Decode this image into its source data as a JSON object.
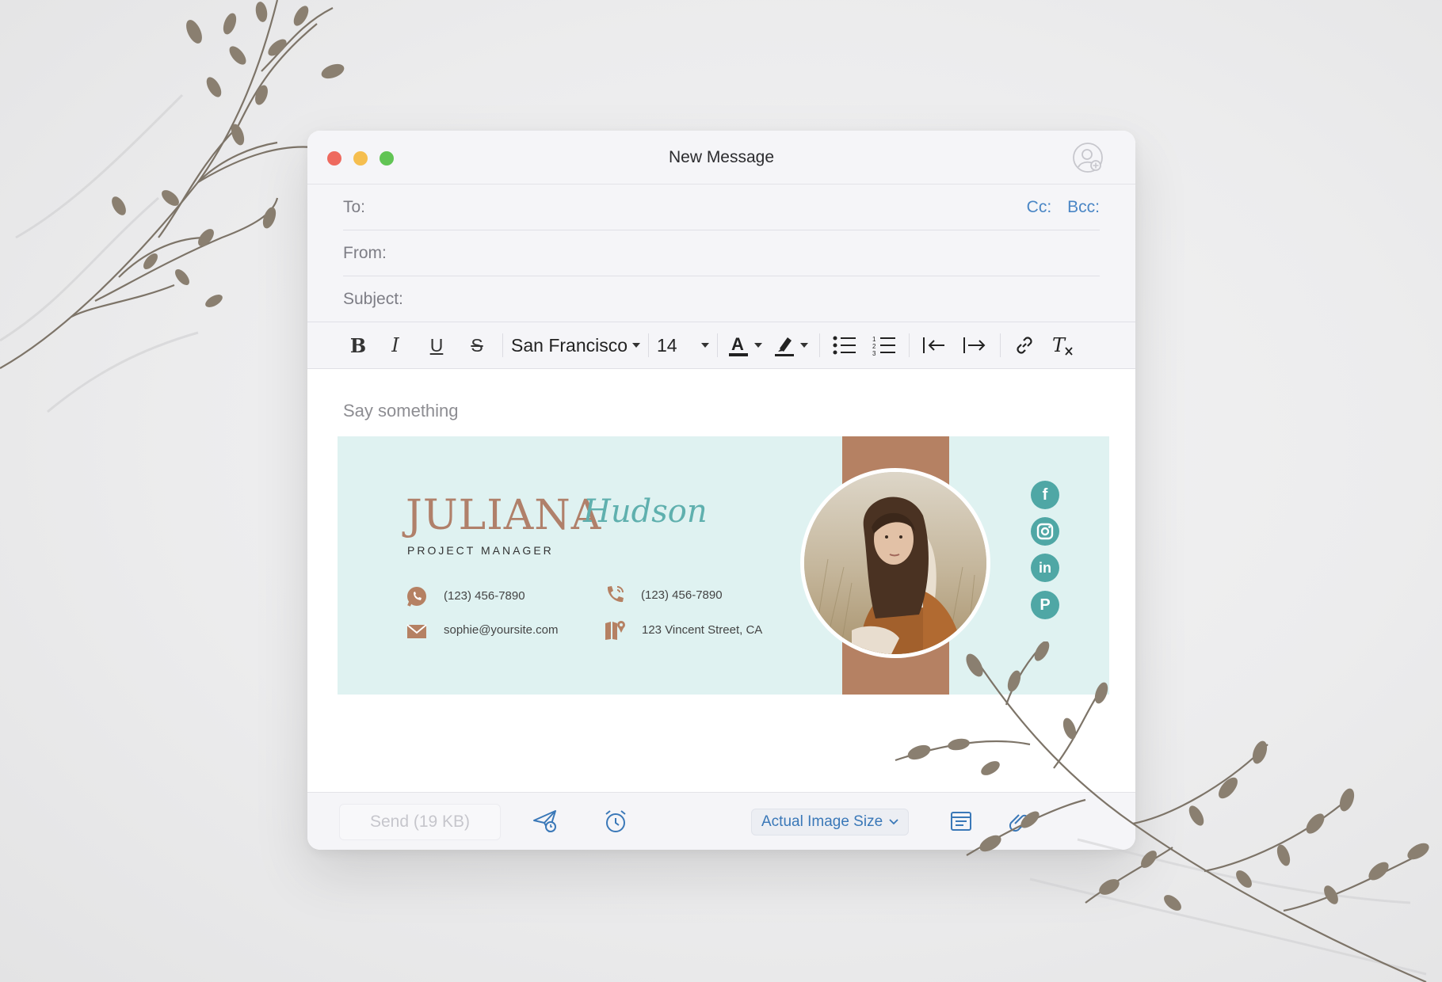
{
  "window": {
    "title": "New Message"
  },
  "headers": {
    "to_label": "To:",
    "from_label": "From:",
    "subject_label": "Subject:",
    "cc_label": "Cc:",
    "bcc_label": "Bcc:"
  },
  "toolbar": {
    "font_family": "San Francisco",
    "font_size": "14",
    "icons": [
      "bold-icon",
      "italic-icon",
      "underline-icon",
      "strikethrough-icon",
      "text-color-icon",
      "highlight-icon",
      "bullet-list-icon",
      "numbered-list-icon",
      "outdent-icon",
      "indent-icon",
      "link-icon",
      "clear-format-icon"
    ]
  },
  "body": {
    "placeholder": "Say something"
  },
  "signature": {
    "first_name": "JULIANA",
    "last_name": "Hudson",
    "role": "PROJECT MANAGER",
    "whatsapp": "(123) 456-7890",
    "phone": "(123) 456-7890",
    "email": "sophie@yoursite.com",
    "address": "123 Vincent Street, CA",
    "social": [
      "facebook-icon",
      "instagram-icon",
      "linkedin-icon",
      "pinterest-icon"
    ],
    "colors": {
      "background": "#dff2f1",
      "stripe": "#b58163",
      "accent": "#4fa7a5",
      "name": "#b0806a"
    }
  },
  "footer": {
    "send_label": "Send (19 KB)",
    "image_size_label": "Actual Image Size"
  }
}
